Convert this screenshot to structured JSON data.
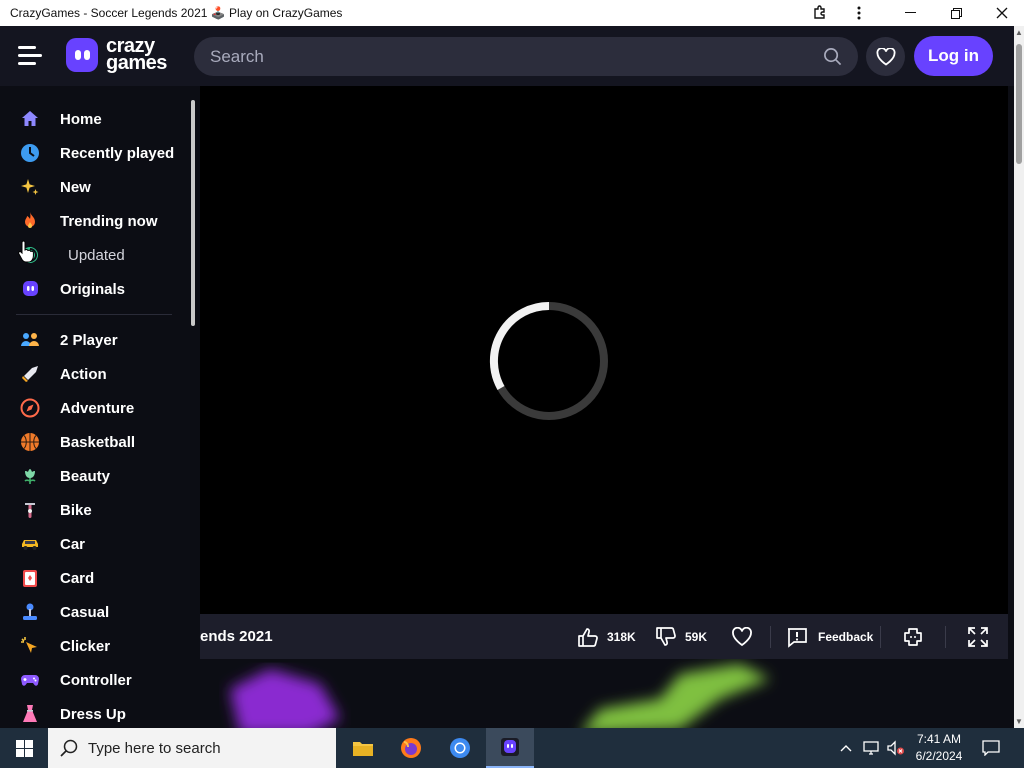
{
  "window": {
    "title": "CrazyGames - Soccer Legends 2021 🕹️ Play on CrazyGames"
  },
  "header": {
    "logo_line1": "crazy",
    "logo_line2": "games",
    "search_placeholder": "Search",
    "login_label": "Log in"
  },
  "sidebar": {
    "top_items": [
      {
        "label": "Home",
        "icon": "home-icon"
      },
      {
        "label": "Recently played",
        "icon": "clock-icon"
      },
      {
        "label": "New",
        "icon": "sparkle-icon"
      },
      {
        "label": "Trending now",
        "icon": "fire-icon"
      },
      {
        "label": "Updated",
        "icon": "refresh-icon"
      },
      {
        "label": "Originals",
        "icon": "crazygames-icon"
      }
    ],
    "category_items": [
      {
        "label": "2 Player",
        "icon": "two-player-icon"
      },
      {
        "label": "Action",
        "icon": "sword-icon"
      },
      {
        "label": "Adventure",
        "icon": "compass-icon"
      },
      {
        "label": "Basketball",
        "icon": "basketball-icon"
      },
      {
        "label": "Beauty",
        "icon": "flower-icon"
      },
      {
        "label": "Bike",
        "icon": "bike-icon"
      },
      {
        "label": "Car",
        "icon": "car-icon"
      },
      {
        "label": "Card",
        "icon": "card-icon"
      },
      {
        "label": "Casual",
        "icon": "joystick-icon"
      },
      {
        "label": "Clicker",
        "icon": "clicker-icon"
      },
      {
        "label": "Controller",
        "icon": "gamepad-icon"
      },
      {
        "label": "Dress Up",
        "icon": "dress-icon"
      }
    ]
  },
  "game_bar": {
    "title": "ends 2021",
    "likes": "318K",
    "dislikes": "59K",
    "feedback": "Feedback"
  },
  "taskbar": {
    "search_placeholder": "Type here to search",
    "time": "7:41 AM",
    "date": "6/2/2024"
  },
  "colors": {
    "brand": "#6842ff",
    "background": "#0c0d14",
    "header": "#141520"
  }
}
